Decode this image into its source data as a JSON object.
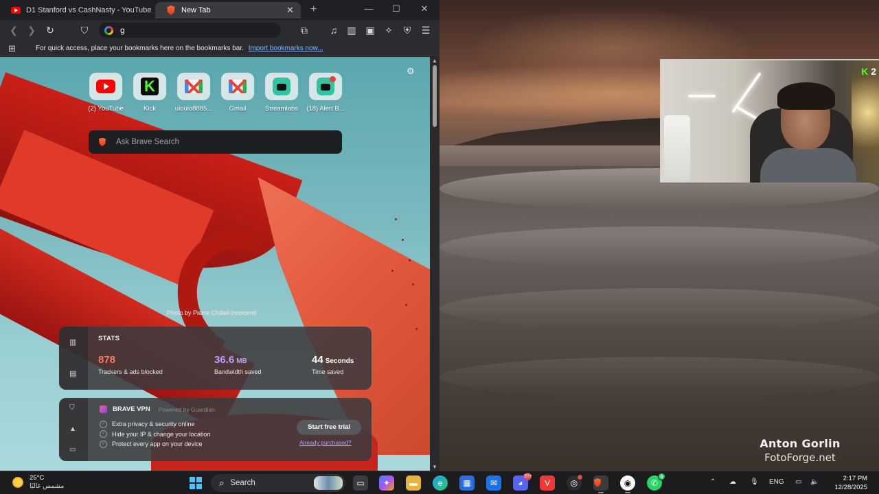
{
  "browser": {
    "tabs": [
      {
        "title": "D1 Stanford vs CashNasty - YouTube",
        "active": false
      },
      {
        "title": "New Tab",
        "active": true
      }
    ],
    "address_value": "g",
    "bookmarks_bar": {
      "message": "For quick access, place your bookmarks here on the bookmarks bar.",
      "import_link": "Import bookmarks now..."
    }
  },
  "new_tab": {
    "shortcuts": [
      {
        "label": "(2) YouTube",
        "icon": "youtube-icon"
      },
      {
        "label": "Kick",
        "icon": "kick-icon"
      },
      {
        "label": "uiouio8885...",
        "icon": "gmail-icon"
      },
      {
        "label": "Gmail",
        "icon": "gmail-icon"
      },
      {
        "label": "Streamlabs",
        "icon": "streamlabs-icon"
      },
      {
        "label": "(18) Alert B...",
        "icon": "streamlabs-alert-icon"
      }
    ],
    "search_placeholder": "Ask Brave Search",
    "photo_credit": "Photo by Pierre Châtel-Innocenti",
    "stats": {
      "title": "STATS",
      "trackers": {
        "value": "878",
        "label": "Trackers & ads blocked"
      },
      "bandwidth": {
        "value": "36.6",
        "unit": "MB",
        "label": "Bandwidth saved"
      },
      "time": {
        "value": "44",
        "unit": "Seconds",
        "label": "Time saved"
      }
    },
    "vpn": {
      "title": "BRAVE VPN",
      "powered_by": "Powered by  Guardian",
      "features": [
        "Extra privacy & security online",
        "Hide your IP & change your location",
        "Protect every app on your device"
      ],
      "cta": "Start free trial",
      "secondary": "Already purchased?"
    }
  },
  "desktop": {
    "watermark_name": "Anton Gorlin",
    "watermark_site": "FotoForge.net",
    "webcam_badge": "2"
  },
  "taskbar": {
    "weather_temp": "25°C",
    "weather_condition": "مشمس غالبًا",
    "search_label": "Search",
    "apps": [
      "file-explorer-icon",
      "copilot-icon",
      "folder-icon",
      "edge-icon",
      "store-icon",
      "mail-icon",
      "discord-icon",
      "vivaldi-icon",
      "chrome-icon",
      "brave-icon",
      "streamlabs-icon",
      "whatsapp-icon"
    ],
    "badges": {
      "discord": "99+",
      "whatsapp": "8"
    },
    "language": "ENG",
    "time": "2:17 PM",
    "date": "12/28/2025"
  },
  "colors": {
    "accent_brave": "#ff5a2e",
    "trackers": "#ff7a5c",
    "bandwidth": "#b7a4ff",
    "kick_green": "#53fc18"
  }
}
